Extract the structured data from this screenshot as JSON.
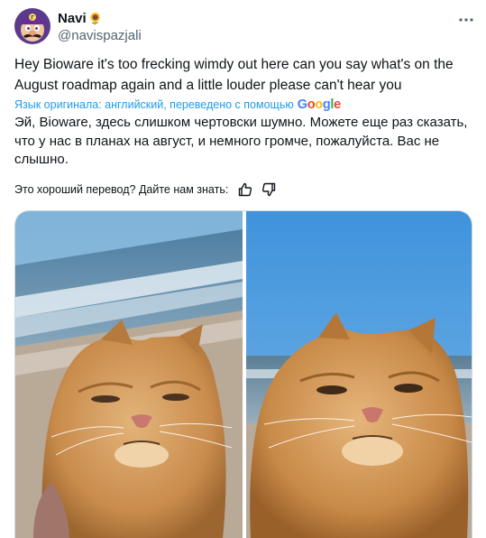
{
  "author": {
    "display_name": "Navi",
    "badge_emoji": "🌻",
    "handle": "@navispazjali",
    "avatar_icon": "waluigi-avatar-icon"
  },
  "menu_icon": "more-horizontal-icon",
  "tweet": {
    "text": "Hey Bioware it's too frecking wimdy out here can you say what's on the August roadmap again and a little louder please can't hear you"
  },
  "translation": {
    "info_label": "Язык оригинала: английский, переведено с помощью",
    "provider": "Google",
    "text": "Эй, Bioware, здесь слишком чертовски шумно. Можете еще раз сказать, что у нас в планах на август, и немного громче, пожалуйста. Вас не слышно.",
    "feedback_question": "Это хороший перевод? Дайте нам знать:",
    "thumbs_up_icon": "thumbs-up-icon",
    "thumbs_down_icon": "thumbs-down-icon"
  },
  "media": {
    "photos": [
      {
        "name": "cat-at-beach-photo-1"
      },
      {
        "name": "cat-at-beach-photo-2"
      }
    ]
  },
  "colors": {
    "text": "#0f1419",
    "secondary": "#536471",
    "link": "#1d9bf0",
    "border": "#cfd9de"
  }
}
